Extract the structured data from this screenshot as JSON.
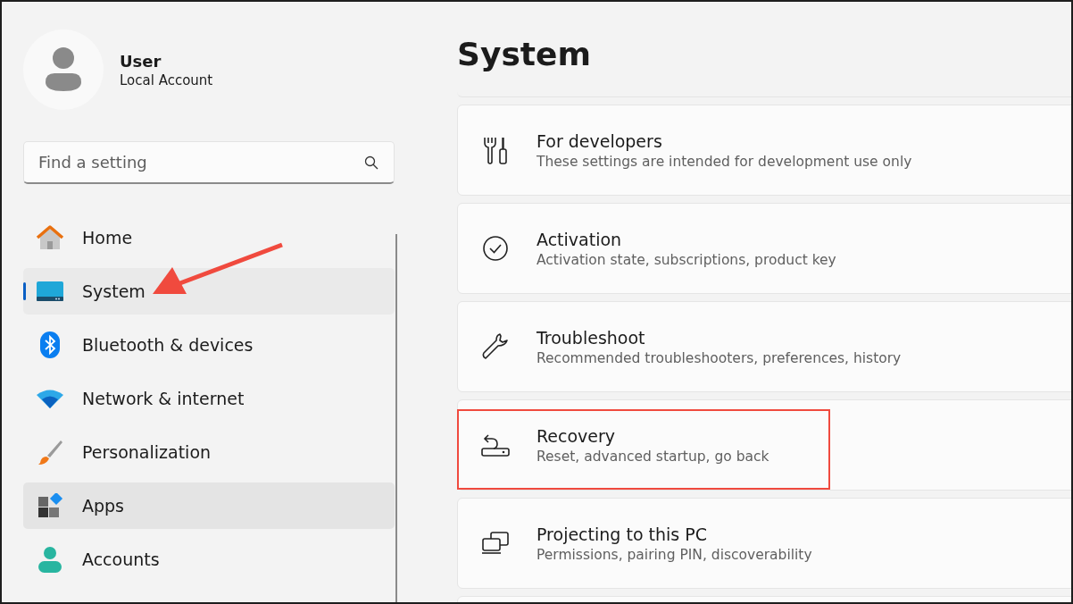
{
  "account": {
    "name": "User",
    "type": "Local Account"
  },
  "search": {
    "placeholder": "Find a setting"
  },
  "nav": [
    {
      "kind": "home",
      "label": "Home",
      "selected": false,
      "hovered": false,
      "pointed": false
    },
    {
      "kind": "system",
      "label": "System",
      "selected": true,
      "hovered": false,
      "pointed": true
    },
    {
      "kind": "bluetooth",
      "label": "Bluetooth & devices",
      "selected": false,
      "hovered": false,
      "pointed": false
    },
    {
      "kind": "network",
      "label": "Network & internet",
      "selected": false,
      "hovered": false,
      "pointed": false
    },
    {
      "kind": "personalization",
      "label": "Personalization",
      "selected": false,
      "hovered": false,
      "pointed": false
    },
    {
      "kind": "apps",
      "label": "Apps",
      "selected": false,
      "hovered": true,
      "pointed": false
    },
    {
      "kind": "accounts",
      "label": "Accounts",
      "selected": false,
      "hovered": false,
      "pointed": false
    }
  ],
  "page_title": "System",
  "cards": [
    {
      "kind": "developers",
      "title": "For developers",
      "description": "These settings are intended for development use only",
      "highlighted": false
    },
    {
      "kind": "activation",
      "title": "Activation",
      "description": "Activation state, subscriptions, product key",
      "highlighted": false
    },
    {
      "kind": "troubleshoot",
      "title": "Troubleshoot",
      "description": "Recommended troubleshooters, preferences, history",
      "highlighted": false
    },
    {
      "kind": "recovery",
      "title": "Recovery",
      "description": "Reset, advanced startup, go back",
      "highlighted": true
    },
    {
      "kind": "projecting",
      "title": "Projecting to this PC",
      "description": "Permissions, pairing PIN, discoverability",
      "highlighted": false
    }
  ]
}
